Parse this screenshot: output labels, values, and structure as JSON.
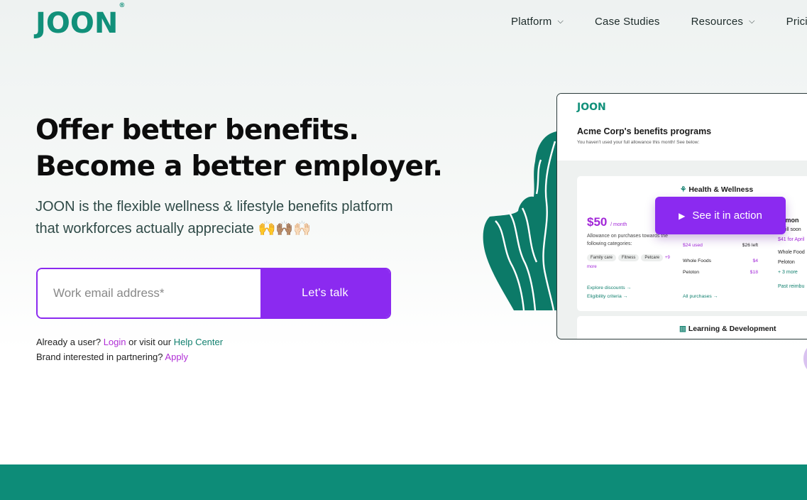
{
  "brand": {
    "name": "JOON",
    "mark": "®"
  },
  "nav": {
    "items": [
      {
        "label": "Platform",
        "dropdown": true
      },
      {
        "label": "Case Studies",
        "dropdown": false
      },
      {
        "label": "Resources",
        "dropdown": true
      },
      {
        "label": "Pricing",
        "dropdown": false
      }
    ]
  },
  "hero": {
    "title_line1": "Offer better benefits.",
    "title_line2": "Become a better employer.",
    "subtitle_line1": "JOON is the flexible wellness & lifestyle benefits platform",
    "subtitle_line2": "that workforces actually appreciate",
    "emoji": "🙌🙌🏽🙌🏻"
  },
  "form": {
    "email_placeholder": "Work email address*",
    "submit_label": "Let's talk"
  },
  "links": {
    "user_prefix": "Already a user?",
    "login": "Login",
    "visit_text": "or visit our",
    "help_center": "Help Center",
    "partner_prefix": "Brand interested in partnering?",
    "apply": "Apply"
  },
  "preview": {
    "logo": "JOON",
    "title": "Acme Corp's benefits programs",
    "note": "You haven't used your full allowance this month! See below:",
    "health_title": "Health & Wellness",
    "price": "$50",
    "price_unit": "/ month",
    "allowance_text": "Allowance on purchases towards the following categories:",
    "chips": [
      "Family care",
      "Fitness",
      "Petcare"
    ],
    "chips_more": "+9 more",
    "used": "$24 used",
    "left": "$26 left",
    "purchases": [
      {
        "name": "Whole Foods",
        "amount": "$4"
      },
      {
        "name": "Peloton",
        "amount": "$18"
      }
    ],
    "explore": "Explore discounts →",
    "eligibility": "Eligibility criteria →",
    "all_purchases": "All purchases →",
    "right_title": "st mon",
    "right_line1": "u will soon",
    "right_line2": "$41 for April",
    "right_item1": "Whole Food",
    "right_item2": "Peloton",
    "right_more": "+ 3 more",
    "right_past": "Past reimbu",
    "ld_title": "Learning & Development",
    "cta": "See it in action"
  },
  "colors": {
    "teal": "#0d8c78",
    "purple": "#8b2af0",
    "pink_link": "#b02fd6"
  }
}
